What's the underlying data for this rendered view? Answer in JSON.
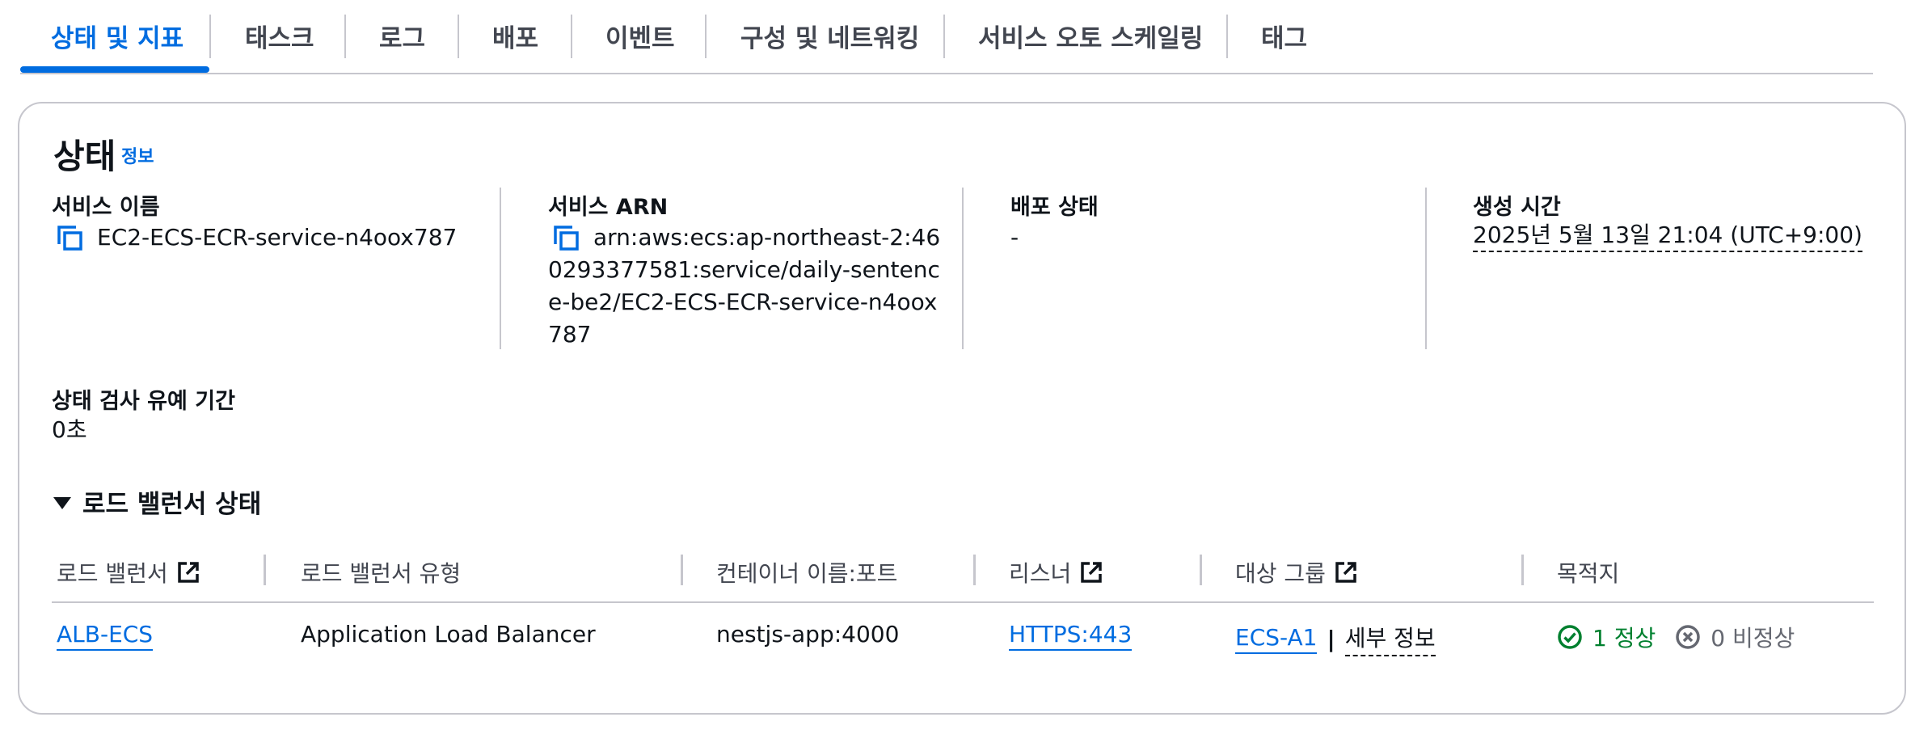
{
  "tabs": [
    {
      "label": "상태 및 지표",
      "active": true
    },
    {
      "label": "태스크"
    },
    {
      "label": "로그"
    },
    {
      "label": "배포"
    },
    {
      "label": "이벤트"
    },
    {
      "label": "구성 및 네트워킹"
    },
    {
      "label": "서비스 오토 스케일링"
    },
    {
      "label": "태그"
    }
  ],
  "status": {
    "heading": "상태",
    "info_link": "정보",
    "service_name_label": "서비스 이름",
    "service_name": "EC2-ECS-ECR-service-n4oox787",
    "service_arn_label": "서비스 ARN",
    "service_arn_lines": [
      "arn:aws:ecs:ap-northeast-2:46",
      "0293377581:service/daily-sentenc",
      "e-be2/EC2-ECS-ECR-service-n4oox",
      "787"
    ],
    "deploy_status_label": "배포 상태",
    "deploy_status": "-",
    "created_label": "생성 시간",
    "created": "2025년 5월 13일 21:04 (UTC+9:00)",
    "grace_label": "상태 검사 유예 기간",
    "grace": "0초"
  },
  "lb": {
    "section_title": "로드 밸런서 상태",
    "headers": [
      "로드 밸런서",
      "로드 밸런서 유형",
      "컨테이너 이름:포트",
      "리스너",
      "대상 그룹",
      "목적지"
    ],
    "row": {
      "lb_name": "ALB-ECS",
      "lb_type": "Application Load Balancer",
      "container_port": "nestjs-app:4000",
      "listener": "HTTPS:443",
      "target_group": "ECS-A1",
      "separator": "|",
      "details": "세부 정보",
      "healthy": "1 정상",
      "unhealthy": "0 비정상"
    }
  },
  "colors": {
    "accent": "#006ce0",
    "success": "#00802f",
    "muted": "#656871",
    "border": "#c6c6cd"
  },
  "icons": [
    "copy-icon",
    "external-link-icon",
    "check-circle-icon",
    "x-circle-icon",
    "caret-down-icon"
  ]
}
